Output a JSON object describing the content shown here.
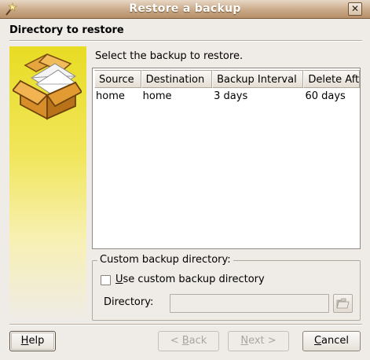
{
  "window": {
    "title": "Restore a backup",
    "close_glyph": "✕"
  },
  "header": {
    "title": "Directory to restore"
  },
  "sidebar": {
    "icon": "package-with-envelopes-icon"
  },
  "main": {
    "prompt": "Select the backup to restore.",
    "table": {
      "columns": [
        "Source",
        "Destination",
        "Backup Interval",
        "Delete Aft"
      ],
      "rows": [
        [
          "home",
          "home",
          "3 days",
          "60 days"
        ]
      ]
    },
    "custom": {
      "legend": "Custom backup directory:",
      "checkbox_label": "Use custom backup directory",
      "checkbox_checked": false,
      "directory_label": "Directory:",
      "directory_value": ""
    }
  },
  "buttons": {
    "help": "Help",
    "back": "< Back",
    "next": "Next >",
    "cancel": "Cancel"
  },
  "colors": {
    "title_bar": "#c9a987",
    "sidebar_accent": "#e8dc24",
    "window_bg": "#efebe7"
  }
}
